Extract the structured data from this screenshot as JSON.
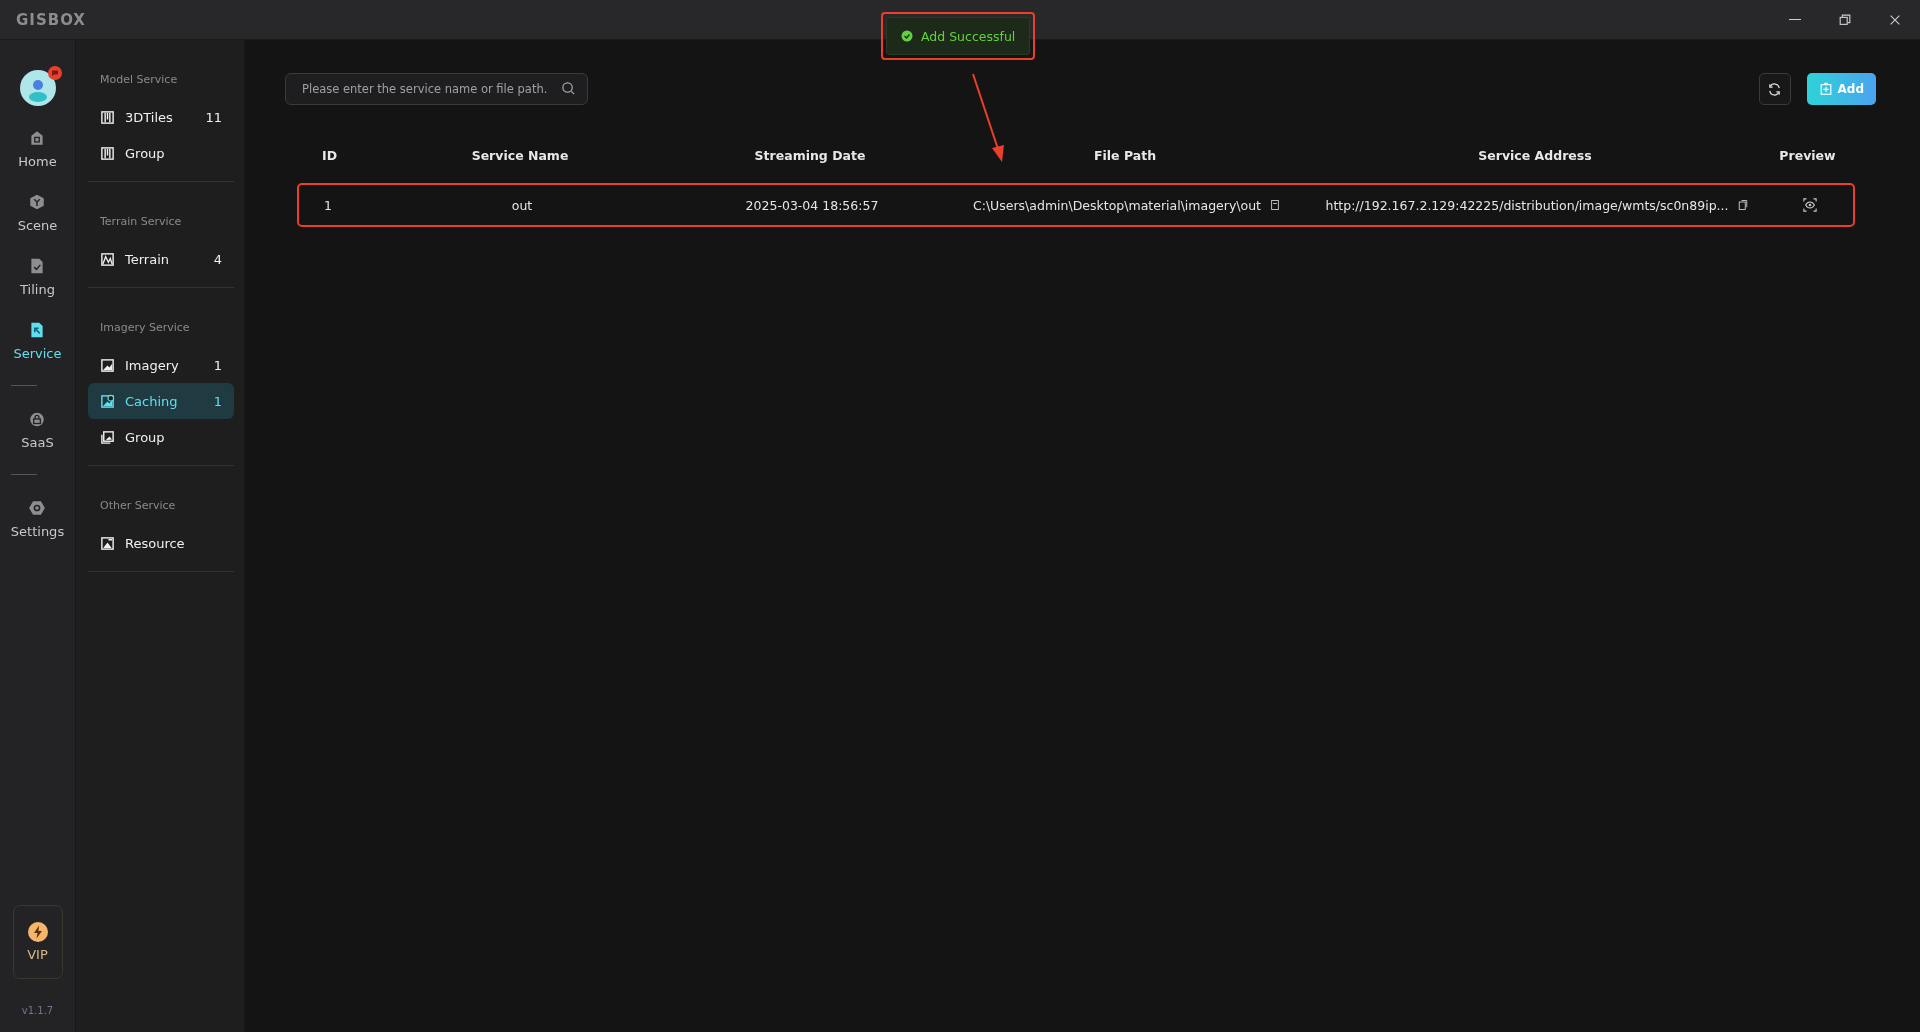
{
  "app": {
    "logo": "GISBOX"
  },
  "nav": {
    "items": [
      {
        "kind": "link",
        "label": "Home",
        "selected": false
      },
      {
        "kind": "link",
        "label": "Scene",
        "selected": false
      },
      {
        "kind": "link",
        "label": "Tiling",
        "selected": false
      },
      {
        "kind": "link",
        "label": "Service",
        "selected": true
      },
      {
        "kind": "divider"
      },
      {
        "kind": "link",
        "label": "SaaS",
        "selected": false
      },
      {
        "kind": "divider"
      },
      {
        "kind": "link",
        "label": "Settings",
        "selected": false
      }
    ],
    "vip": {
      "label": "VIP"
    },
    "version": "v1.1.7"
  },
  "sidebar": {
    "groups": [
      {
        "title": "Model Service",
        "items": [
          {
            "label": "3DTiles",
            "count": "11",
            "selected": false
          },
          {
            "label": "Group",
            "selected": false
          }
        ]
      },
      {
        "title": "Terrain Service",
        "items": [
          {
            "label": "Terrain",
            "count": "4",
            "selected": false
          }
        ]
      },
      {
        "title": "Imagery Service",
        "items": [
          {
            "label": "Imagery",
            "count": "1",
            "selected": false
          },
          {
            "label": "Caching",
            "count": "1",
            "selected": true
          },
          {
            "label": "Group",
            "selected": false
          }
        ]
      },
      {
        "title": "Other Service",
        "items": [
          {
            "label": "Resource",
            "selected": false
          }
        ]
      }
    ]
  },
  "toast": {
    "message": "Add Successful"
  },
  "search": {
    "placeholder": "Please enter the service name or file path."
  },
  "add_button": "Add",
  "table": {
    "columns": [
      "ID",
      "Service Name",
      "Streaming Date",
      "File Path",
      "Service Address",
      "Preview"
    ],
    "rows": [
      {
        "id": "1",
        "service_name": "out",
        "streaming_date": "2025-03-04 18:56:57",
        "file_path": "C:\\Users\\admin\\Desktop\\material\\imagery\\out",
        "service_address": "http://192.167.2.129:42225/distribution/image/wmts/sc0n89ip...",
        "highlighted": true
      }
    ]
  }
}
